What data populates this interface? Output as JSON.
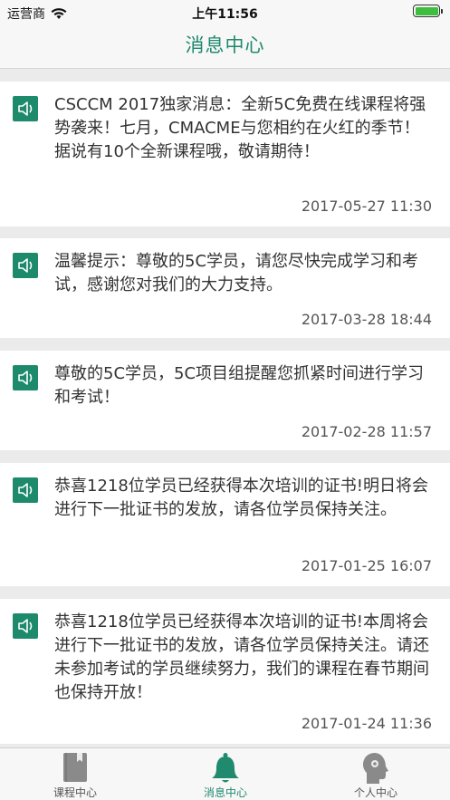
{
  "status": {
    "carrier": "运营商",
    "time": "上午11:56"
  },
  "nav": {
    "title": "消息中心"
  },
  "messages": [
    {
      "text": "CSCCM 2017独家消息：全新5C免费在线课程将强势袭来！七月，CMACME与您相约在火红的季节！据说有10个全新课程哦，敬请期待！",
      "time": "2017-05-27 11:30"
    },
    {
      "text": "温馨提示：尊敬的5C学员，请您尽快完成学习和考试，感谢您对我们的大力支持。",
      "time": "2017-03-28 18:44"
    },
    {
      "text": "尊敬的5C学员，5C项目组提醒您抓紧时间进行学习和考试！",
      "time": "2017-02-28 11:57"
    },
    {
      "text": "恭喜1218位学员已经获得本次培训的证书!明日将会进行下一批证书的发放，请各位学员保持关注。",
      "time": "2017-01-25 16:07"
    },
    {
      "text": "恭喜1218位学员已经获得本次培训的证书!本周将会进行下一批证书的发放，请各位学员保持关注。请还未参加考试的学员继续努力，我们的课程在春节期间也保持开放！",
      "time": "2017-01-24 11:36"
    }
  ],
  "tabs": [
    {
      "label": "课程中心",
      "icon": "book-icon"
    },
    {
      "label": "消息中心",
      "icon": "bell-icon"
    },
    {
      "label": "个人中心",
      "icon": "person-head-icon"
    }
  ],
  "colors": {
    "accent": "#1f8a6e",
    "icon_bg": "#1c8a6b",
    "battery": "#3ebd3e"
  }
}
